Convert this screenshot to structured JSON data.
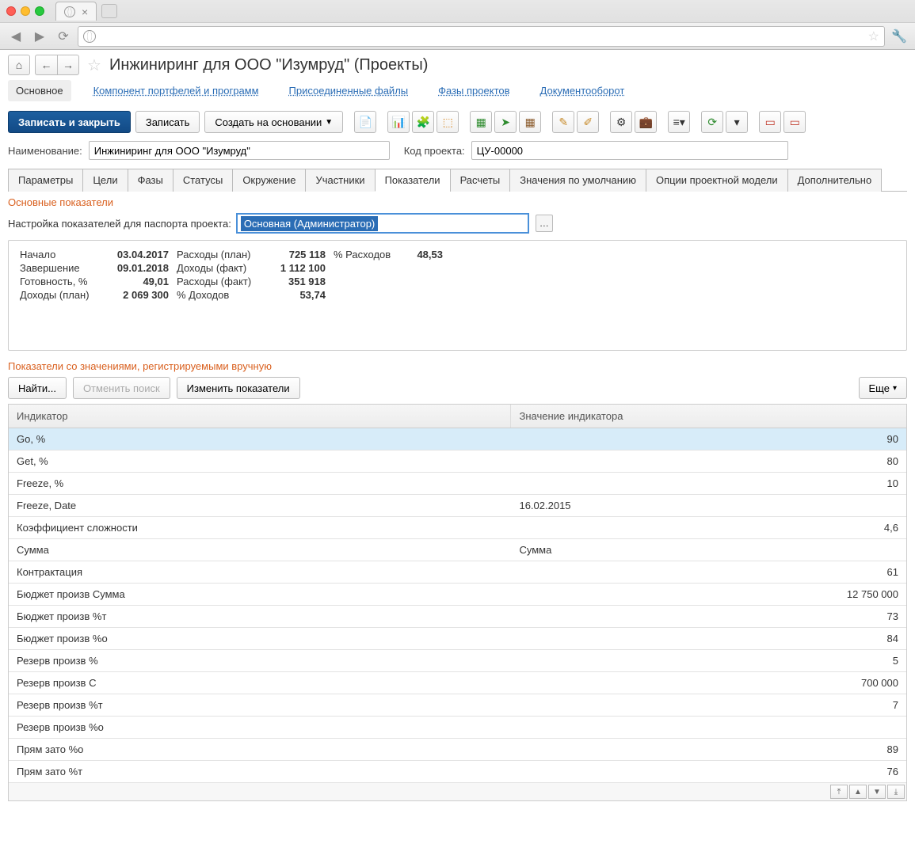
{
  "page_title": "Инжиниринг для ООО \"Изумруд\" (Проекты)",
  "link_tabs": {
    "main": "Основное",
    "component": "Компонент портфелей и программ",
    "files": "Присоединенные файлы",
    "phases": "Фазы проектов",
    "docflow": "Документооборот"
  },
  "toolbar": {
    "save_close": "Записать и закрыть",
    "save": "Записать",
    "create_based": "Создать на основании"
  },
  "fields": {
    "name_label": "Наименование:",
    "name_value": "Инжиниринг для ООО \"Изумруд\"",
    "code_label": "Код проекта:",
    "code_value": "ЦУ-00000"
  },
  "tabs": [
    "Параметры",
    "Цели",
    "Фазы",
    "Статусы",
    "Окружение",
    "Участники",
    "Показатели",
    "Расчеты",
    "Значения  по умолчанию",
    "Опции проектной модели",
    "Дополнительно"
  ],
  "active_tab": "Показатели",
  "sections": {
    "main_indicators": "Основные показатели",
    "passport_label": "Настройка показателей для паспорта проекта:",
    "passport_value": "Основная (Администратор)",
    "manual_indicators": "Показатели со значениями, регистрируемыми вручную"
  },
  "summary": [
    {
      "label": "Начало",
      "value": "03.04.2017"
    },
    {
      "label": "Завершение",
      "value": "09.01.2018"
    },
    {
      "label": "Готовность, %",
      "value": "49,01"
    },
    {
      "label": "Доходы (план)",
      "value": "2 069 300"
    },
    {
      "label": "Расходы (план)",
      "value": "725 118"
    },
    {
      "label": "Доходы (факт)",
      "value": "1 112 100"
    },
    {
      "label": "Расходы (факт)",
      "value": "351 918"
    },
    {
      "label": "% Доходов",
      "value": "53,74"
    },
    {
      "label": "% Расходов",
      "value": "48,53"
    }
  ],
  "ind_toolbar": {
    "find": "Найти...",
    "cancel_find": "Отменить поиск",
    "edit": "Изменить показатели",
    "more": "Еще"
  },
  "table": {
    "columns": [
      "Индикатор",
      "Значение индикатора"
    ],
    "rows": [
      {
        "name": "Go, %",
        "value": "90",
        "num": true,
        "selected": true
      },
      {
        "name": "Get, %",
        "value": "80",
        "num": true
      },
      {
        "name": "Freeze, %",
        "value": "10",
        "num": true
      },
      {
        "name": "Freeze, Date",
        "value": "16.02.2015",
        "num": false
      },
      {
        "name": "Коэффициент сложности",
        "value": "4,6",
        "num": true
      },
      {
        "name": "Сумма",
        "value": "Сумма",
        "num": false
      },
      {
        "name": "Контрактация",
        "value": "61",
        "num": true
      },
      {
        "name": "Бюджет произв Сумма",
        "value": "12 750 000",
        "num": true
      },
      {
        "name": "Бюджет произв %т",
        "value": "73",
        "num": true
      },
      {
        "name": "Бюджет произв %о",
        "value": "84",
        "num": true
      },
      {
        "name": "Резерв произв %",
        "value": "5",
        "num": true
      },
      {
        "name": "Резерв произв С",
        "value": "700 000",
        "num": true
      },
      {
        "name": "Резерв произв %т",
        "value": "7",
        "num": true
      },
      {
        "name": "Резерв произв %о",
        "value": "",
        "num": true
      },
      {
        "name": "Прям зато %о",
        "value": "89",
        "num": true
      },
      {
        "name": "Прям зато %т",
        "value": "76",
        "num": true
      }
    ]
  }
}
